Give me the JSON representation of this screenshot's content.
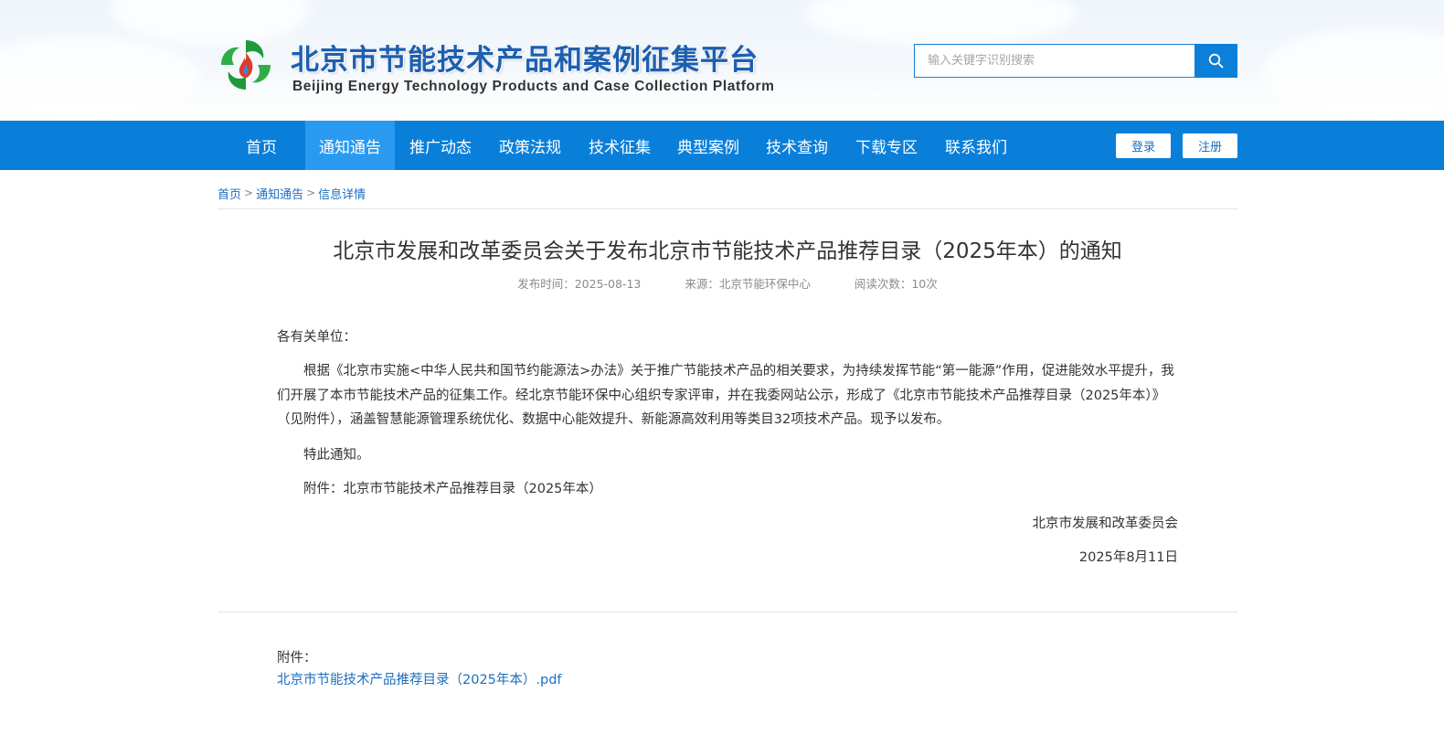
{
  "site": {
    "title_cn": "北京市节能技术产品和案例征集平台",
    "title_en": "Beijing Energy Technology Products and Case Collection Platform"
  },
  "search": {
    "placeholder": "输入关键字识别搜索"
  },
  "nav": {
    "items": [
      {
        "label": "首页"
      },
      {
        "label": "通知通告"
      },
      {
        "label": "推广动态"
      },
      {
        "label": "政策法规"
      },
      {
        "label": "技术征集"
      },
      {
        "label": "典型案例"
      },
      {
        "label": "技术查询"
      },
      {
        "label": "下载专区"
      },
      {
        "label": "联系我们"
      }
    ],
    "active": "通知通告",
    "login_label": "登录",
    "register_label": "注册"
  },
  "breadcrumb": [
    "首页",
    "通知通告",
    "信息详情"
  ],
  "article": {
    "title": "北京市发展和改革委员会关于发布北京市节能技术产品推荐目录（2025年本）的通知",
    "publish_time": "发布时间：2025-08-13",
    "source": "来源：北京节能环保中心",
    "views": "阅读次数：10次",
    "salutation": "各有关单位：",
    "paragraph": "根据《北京市实施<中华人民共和国节约能源法>办法》关于推广节能技术产品的相关要求，为持续发挥节能“第一能源”作用，促进能效水平提升，我们开展了本市节能技术产品的征集工作。经北京节能环保中心组织专家评审，并在我委网站公示，形成了《北京市节能技术产品推荐目录（2025年本）》（见附件），涵盖智慧能源管理系统优化、数据中心能效提升、新能源高效利用等类目32项技术产品。现予以发布。",
    "closing": "特此通知。",
    "attachment_note": "附件：北京市节能技术产品推荐目录（2025年本）",
    "issuer": "北京市发展和改革委员会",
    "date": "2025年8月11日"
  },
  "attachments": {
    "label": "附件：",
    "files": [
      "北京市节能技术产品推荐目录（2025年本）.pdf"
    ]
  },
  "colors": {
    "nav_bg": "#0a7fd9",
    "nav_active": "#2a9af0",
    "link": "#1b6fc0",
    "title_blue": "#1d5fb0"
  }
}
